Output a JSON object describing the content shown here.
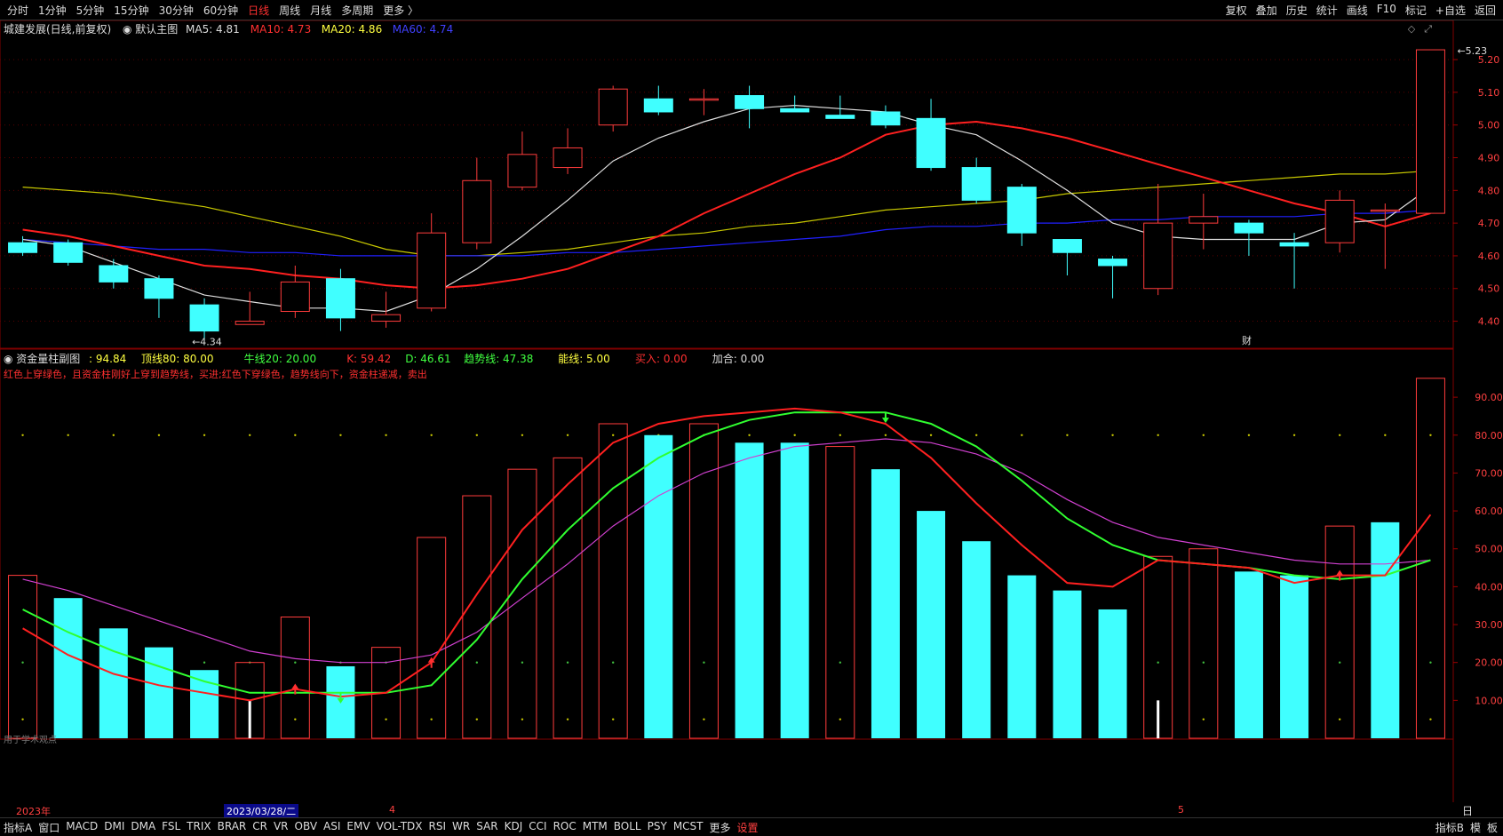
{
  "toolbar": {
    "periods": [
      "分时",
      "1分钟",
      "5分钟",
      "15分钟",
      "30分钟",
      "60分钟",
      "日线",
      "周线",
      "月线",
      "多周期",
      "更多 〉"
    ],
    "active_period": "日线",
    "right": [
      "复权",
      "叠加",
      "历史",
      "统计",
      "画线",
      "F10",
      "标记",
      "+自选",
      "返回"
    ]
  },
  "main_chart": {
    "title": "城建发展(日线,前复权)",
    "indicator_name": "默认主图",
    "ma5": "MA5: 4.81",
    "ma10": "MA10: 4.73",
    "ma20": "MA20: 4.86",
    "ma60": "MA60: 4.74",
    "high_label": "5.23",
    "low_label": "4.34",
    "fin_marker": "财",
    "y_ticks": [
      "5.20",
      "5.10",
      "5.00",
      "4.90",
      "4.80",
      "4.70",
      "4.60",
      "4.50",
      "4.40"
    ],
    "y_range": [
      4.32,
      5.26
    ],
    "candles": [
      {
        "o": 4.64,
        "c": 4.61,
        "h": 4.66,
        "l": 4.6
      },
      {
        "o": 4.64,
        "c": 4.58,
        "h": 4.65,
        "l": 4.57
      },
      {
        "o": 4.57,
        "c": 4.52,
        "h": 4.59,
        "l": 4.5
      },
      {
        "o": 4.53,
        "c": 4.47,
        "h": 4.54,
        "l": 4.41
      },
      {
        "o": 4.45,
        "c": 4.37,
        "h": 4.47,
        "l": 4.34
      },
      {
        "o": 4.39,
        "c": 4.4,
        "h": 4.49,
        "l": 4.39
      },
      {
        "o": 4.43,
        "c": 4.52,
        "h": 4.57,
        "l": 4.41
      },
      {
        "o": 4.53,
        "c": 4.41,
        "h": 4.56,
        "l": 4.37
      },
      {
        "o": 4.4,
        "c": 4.42,
        "h": 4.49,
        "l": 4.38
      },
      {
        "o": 4.44,
        "c": 4.67,
        "h": 4.73,
        "l": 4.43
      },
      {
        "o": 4.64,
        "c": 4.83,
        "h": 4.9,
        "l": 4.62
      },
      {
        "o": 4.81,
        "c": 4.91,
        "h": 4.98,
        "l": 4.8
      },
      {
        "o": 4.87,
        "c": 4.93,
        "h": 4.99,
        "l": 4.85
      },
      {
        "o": 5.0,
        "c": 5.11,
        "h": 5.12,
        "l": 4.98
      },
      {
        "o": 5.08,
        "c": 5.04,
        "h": 5.12,
        "l": 5.03
      },
      {
        "o": 5.08,
        "c": 5.08,
        "h": 5.11,
        "l": 5.03
      },
      {
        "o": 5.09,
        "c": 5.05,
        "h": 5.12,
        "l": 4.99
      },
      {
        "o": 5.05,
        "c": 5.04,
        "h": 5.09,
        "l": 5.04
      },
      {
        "o": 5.03,
        "c": 5.02,
        "h": 5.09,
        "l": 5.02
      },
      {
        "o": 5.04,
        "c": 5.0,
        "h": 5.06,
        "l": 4.99
      },
      {
        "o": 5.02,
        "c": 4.87,
        "h": 5.08,
        "l": 4.86
      },
      {
        "o": 4.87,
        "c": 4.77,
        "h": 4.9,
        "l": 4.76
      },
      {
        "o": 4.81,
        "c": 4.67,
        "h": 4.82,
        "l": 4.63
      },
      {
        "o": 4.65,
        "c": 4.61,
        "h": 4.65,
        "l": 4.54
      },
      {
        "o": 4.59,
        "c": 4.57,
        "h": 4.6,
        "l": 4.47
      },
      {
        "o": 4.5,
        "c": 4.7,
        "h": 4.82,
        "l": 4.48
      },
      {
        "o": 4.7,
        "c": 4.72,
        "h": 4.79,
        "l": 4.62
      },
      {
        "o": 4.7,
        "c": 4.67,
        "h": 4.71,
        "l": 4.6
      },
      {
        "o": 4.64,
        "c": 4.63,
        "h": 4.67,
        "l": 4.5
      },
      {
        "o": 4.64,
        "c": 4.77,
        "h": 4.8,
        "l": 4.61
      },
      {
        "o": 4.74,
        "c": 4.74,
        "h": 4.76,
        "l": 4.56
      },
      {
        "o": 4.73,
        "c": 5.23,
        "h": 5.23,
        "l": 4.73
      }
    ],
    "ma5_values": [
      4.65,
      4.63,
      4.58,
      4.53,
      4.48,
      4.46,
      4.44,
      4.44,
      4.43,
      4.48,
      4.56,
      4.66,
      4.77,
      4.89,
      4.96,
      5.01,
      5.05,
      5.06,
      5.05,
      5.04,
      5.0,
      4.97,
      4.89,
      4.8,
      4.7,
      4.66,
      4.65,
      4.65,
      4.65,
      4.7,
      4.71,
      4.81
    ],
    "ma10_values": [
      4.68,
      4.66,
      4.63,
      4.6,
      4.57,
      4.56,
      4.54,
      4.53,
      4.51,
      4.5,
      4.51,
      4.53,
      4.56,
      4.61,
      4.66,
      4.73,
      4.79,
      4.85,
      4.9,
      4.97,
      5.0,
      5.01,
      4.99,
      4.96,
      4.92,
      4.88,
      4.84,
      4.8,
      4.76,
      4.73,
      4.69,
      4.73
    ],
    "ma20_values": [
      4.81,
      4.8,
      4.79,
      4.77,
      4.75,
      4.72,
      4.69,
      4.66,
      4.62,
      4.6,
      4.6,
      4.61,
      4.62,
      4.64,
      4.66,
      4.67,
      4.69,
      4.7,
      4.72,
      4.74,
      4.75,
      4.76,
      4.77,
      4.79,
      4.8,
      4.81,
      4.82,
      4.83,
      4.84,
      4.85,
      4.85,
      4.86
    ],
    "ma60_values": [
      4.65,
      4.64,
      4.63,
      4.62,
      4.62,
      4.61,
      4.61,
      4.6,
      4.6,
      4.6,
      4.6,
      4.6,
      4.61,
      4.61,
      4.62,
      4.63,
      4.64,
      4.65,
      4.66,
      4.68,
      4.69,
      4.69,
      4.7,
      4.7,
      4.71,
      4.71,
      4.72,
      4.72,
      4.72,
      4.73,
      4.73,
      4.74
    ]
  },
  "sub_chart": {
    "title": "资金量柱副图",
    "legend": [
      {
        "label": ": 94.84",
        "color": "#ffff40"
      },
      {
        "label": "顶线80: 80.00",
        "color": "#ffff40"
      },
      {
        "label": "牛线20: 20.00",
        "color": "#40ff40"
      },
      {
        "label": "K: 59.42",
        "color": "#ff3030"
      },
      {
        "label": "D: 46.61",
        "color": "#40ff40"
      },
      {
        "label": "趋势线: 47.38",
        "color": "#40ff40"
      },
      {
        "label": "能线: 5.00",
        "color": "#ffff40"
      },
      {
        "label": "买入: 0.00",
        "color": "#ff3030"
      },
      {
        "label": "加合: 0.00",
        "color": "#dddddd"
      }
    ],
    "note": "红色上穿绿色，且资金柱刚好上穿到趋势线，买进;红色下穿绿色，趋势线向下，资金柱递减，卖出",
    "footnote": "用于学术观点",
    "y_ticks": [
      "90.00",
      "80.00",
      "70.00",
      "60.00",
      "50.00",
      "40.00",
      "30.00",
      "20.00",
      "10.00"
    ],
    "y_range": [
      0,
      98
    ],
    "bars": [
      {
        "v": 43,
        "t": "hollow"
      },
      {
        "v": 37,
        "t": "solid"
      },
      {
        "v": 29,
        "t": "solid"
      },
      {
        "v": 24,
        "t": "solid"
      },
      {
        "v": 18,
        "t": "solid"
      },
      {
        "v": 20,
        "t": "hollow"
      },
      {
        "v": 32,
        "t": "hollow"
      },
      {
        "v": 19,
        "t": "solid"
      },
      {
        "v": 24,
        "t": "hollow"
      },
      {
        "v": 53,
        "t": "hollow"
      },
      {
        "v": 64,
        "t": "hollow"
      },
      {
        "v": 71,
        "t": "hollow"
      },
      {
        "v": 74,
        "t": "hollow"
      },
      {
        "v": 83,
        "t": "hollow"
      },
      {
        "v": 80,
        "t": "solid"
      },
      {
        "v": 83,
        "t": "hollow"
      },
      {
        "v": 78,
        "t": "solid"
      },
      {
        "v": 78,
        "t": "solid"
      },
      {
        "v": 77,
        "t": "hollow"
      },
      {
        "v": 71,
        "t": "solid"
      },
      {
        "v": 60,
        "t": "solid"
      },
      {
        "v": 52,
        "t": "solid"
      },
      {
        "v": 43,
        "t": "solid"
      },
      {
        "v": 39,
        "t": "solid"
      },
      {
        "v": 34,
        "t": "solid"
      },
      {
        "v": 48,
        "t": "hollow"
      },
      {
        "v": 50,
        "t": "hollow"
      },
      {
        "v": 44,
        "t": "solid"
      },
      {
        "v": 43,
        "t": "solid"
      },
      {
        "v": 56,
        "t": "hollow"
      },
      {
        "v": 57,
        "t": "solid"
      },
      {
        "v": 95,
        "t": "hollow"
      }
    ],
    "k_values": [
      29,
      22,
      17,
      14,
      12,
      10,
      13,
      11,
      12,
      20,
      38,
      55,
      67,
      78,
      83,
      85,
      86,
      87,
      86,
      83,
      74,
      62,
      51,
      41,
      40,
      47,
      46,
      45,
      41,
      43,
      43,
      59
    ],
    "d_values": [
      34,
      28,
      23,
      19,
      15,
      12,
      12,
      12,
      12,
      14,
      26,
      42,
      55,
      66,
      74,
      80,
      84,
      86,
      86,
      86,
      83,
      77,
      68,
      58,
      51,
      47,
      46,
      45,
      43,
      42,
      43,
      47
    ],
    "trend_values": [
      42,
      39,
      35,
      31,
      27,
      23,
      21,
      20,
      20,
      22,
      28,
      37,
      46,
      56,
      64,
      70,
      74,
      77,
      78,
      79,
      78,
      75,
      70,
      63,
      57,
      53,
      51,
      49,
      47,
      46,
      46,
      47
    ],
    "buy_signals": [
      6,
      9,
      29
    ],
    "sell_signals": [
      7,
      19
    ],
    "white_marks": [
      {
        "i": 5,
        "v": 10
      },
      {
        "i": 25,
        "v": 10
      }
    ]
  },
  "dates": {
    "d1": "2023年",
    "d2": "2023/03/28/二",
    "d3": "4",
    "d4": "5",
    "right": "日线"
  },
  "bottom_tabs": [
    "指标A",
    "窗口",
    "MACD",
    "DMI",
    "DMA",
    "FSL",
    "TRIX",
    "BRAR",
    "CR",
    "VR",
    "OBV",
    "ASI",
    "EMV",
    "VOL-TDX",
    "RSI",
    "WR",
    "SAR",
    "KDJ",
    "CCI",
    "ROC",
    "MTM",
    "BOLL",
    "PSY",
    "MCST",
    "更多",
    "设置"
  ],
  "bottom_right": [
    "指标B",
    "模",
    "板"
  ]
}
